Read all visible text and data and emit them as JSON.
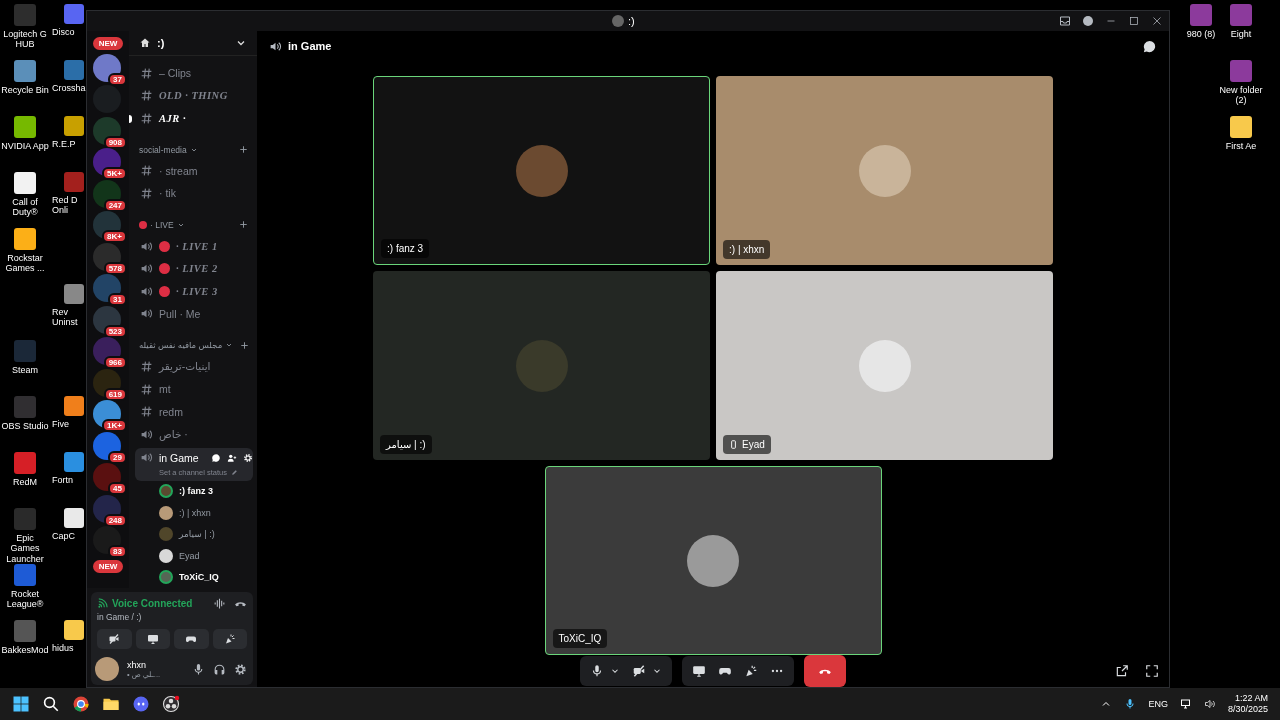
{
  "desktop": {
    "left_icons": [
      {
        "label": "Logitech G HUB"
      },
      {
        "label": "Recycle Bin"
      },
      {
        "label": "NVIDIA App"
      },
      {
        "label": "Call of Duty®"
      },
      {
        "label": "Rockstar Games ..."
      },
      {
        "label": "Steam"
      },
      {
        "label": "OBS Studio"
      },
      {
        "label": "RedM"
      },
      {
        "label": "Epic Games Launcher"
      },
      {
        "label": "Rocket League®"
      },
      {
        "label": "BakkesMod"
      }
    ],
    "second_column_icons": [
      {
        "label": "Disco"
      },
      {
        "label": "Crossha"
      },
      {
        "label": "R.E.P"
      },
      {
        "label": "Red D Onli"
      },
      {
        "label": "Rev Uninst"
      },
      {
        "label": "Five"
      },
      {
        "label": "Fortn"
      },
      {
        "label": "CapC"
      },
      {
        "label": "hidus"
      }
    ],
    "right_icons": [
      {
        "label": "980 (8)"
      },
      {
        "label": "Eight"
      },
      {
        "label": "New folder (2)"
      },
      {
        "label": "First Ae"
      }
    ]
  },
  "window": {
    "title": ":)"
  },
  "servers": [
    {
      "kind": "new",
      "label": "NEW"
    },
    {
      "kind": "server",
      "badge": "37"
    },
    {
      "kind": "server"
    },
    {
      "kind": "server",
      "badge": "908"
    },
    {
      "kind": "server",
      "badge": "5K+"
    },
    {
      "kind": "server",
      "badge": "247"
    },
    {
      "kind": "server",
      "badge": "8K+"
    },
    {
      "kind": "server",
      "badge": "578"
    },
    {
      "kind": "server",
      "badge": "31"
    },
    {
      "kind": "server",
      "badge": "523"
    },
    {
      "kind": "server",
      "badge": "966"
    },
    {
      "kind": "server",
      "badge": "619"
    },
    {
      "kind": "server",
      "badge": "1K+"
    },
    {
      "kind": "server",
      "badge": "29"
    },
    {
      "kind": "server",
      "badge": "45"
    },
    {
      "kind": "server",
      "badge": "248"
    },
    {
      "kind": "server",
      "badge": "83"
    },
    {
      "kind": "new",
      "label": "NEW"
    }
  ],
  "server_name": ":)",
  "channels": [
    {
      "kind": "text",
      "name": "– Clips",
      "styled": false,
      "unread": false,
      "live": false,
      "selected": false
    },
    {
      "kind": "text",
      "name": "OLD · THING",
      "styled": true,
      "unread": false,
      "live": false,
      "selected": false
    },
    {
      "kind": "text",
      "name": "AJR ·",
      "styled": true,
      "unread": true,
      "live": false,
      "selected": false
    },
    {
      "kind": "category",
      "name": "social-media",
      "live": false
    },
    {
      "kind": "text",
      "name": "· stream",
      "styled": false,
      "unread": false,
      "live": false,
      "selected": false
    },
    {
      "kind": "text",
      "name": "· tik",
      "styled": false,
      "unread": false,
      "live": false,
      "selected": false
    },
    {
      "kind": "category",
      "name": "· LIVE",
      "live": true
    },
    {
      "kind": "voice",
      "name": "· LIVE 1",
      "styled": true,
      "unread": false,
      "live": true,
      "selected": false
    },
    {
      "kind": "voice",
      "name": "· LIVE 2",
      "styled": true,
      "unread": false,
      "live": true,
      "selected": false
    },
    {
      "kind": "voice",
      "name": "· LIVE 3",
      "styled": true,
      "unread": false,
      "live": true,
      "selected": false
    },
    {
      "kind": "voice",
      "name": "Pull · Me",
      "styled": false,
      "unread": false,
      "live": false,
      "selected": false
    },
    {
      "kind": "category",
      "name": "مجلس مافيه نفس ثقيله",
      "live": false
    },
    {
      "kind": "text",
      "name": "اينيات-تريقر",
      "styled": false,
      "unread": false,
      "live": false,
      "selected": false
    },
    {
      "kind": "text",
      "name": "mt",
      "styled": false,
      "unread": false,
      "live": false,
      "selected": false
    },
    {
      "kind": "text",
      "name": "redm",
      "styled": false,
      "unread": false,
      "live": false,
      "selected": false
    },
    {
      "kind": "voice",
      "name": "خاص ·",
      "styled": false,
      "unread": false,
      "live": false,
      "selected": false
    },
    {
      "kind": "voice",
      "name": "in Game",
      "styled": false,
      "unread": false,
      "live": false,
      "selected": true,
      "status_placeholder": "Set a channel status",
      "members": [
        {
          "name": ":) fanz 3",
          "speaking": true
        },
        {
          "name": ":) | xhxn",
          "speaking": false
        },
        {
          "name": "سيامر | :)",
          "speaking": false
        },
        {
          "name": "Eyad",
          "speaking": false
        },
        {
          "name": "ToXiC_IQ",
          "speaking": true
        }
      ]
    }
  ],
  "voice_panel": {
    "status": "Voice Connected",
    "location": "in Game / :)"
  },
  "user": {
    "name": "xhxn",
    "status": "• ـلي ص..."
  },
  "call": {
    "channel": "in Game",
    "tiles": [
      {
        "name": ":) fanz 3",
        "speaking": true,
        "mobile": false
      },
      {
        "name": ":) | xhxn",
        "speaking": false,
        "mobile": false
      },
      {
        "name": "سيامر | :)",
        "speaking": false,
        "mobile": false
      },
      {
        "name": "Eyad",
        "speaking": false,
        "mobile": true
      },
      {
        "name": "ToXiC_IQ",
        "speaking": true,
        "mobile": false
      }
    ]
  },
  "taskbar": {
    "language": "ENG",
    "time": "1:22 AM",
    "date": "8/30/2025"
  }
}
